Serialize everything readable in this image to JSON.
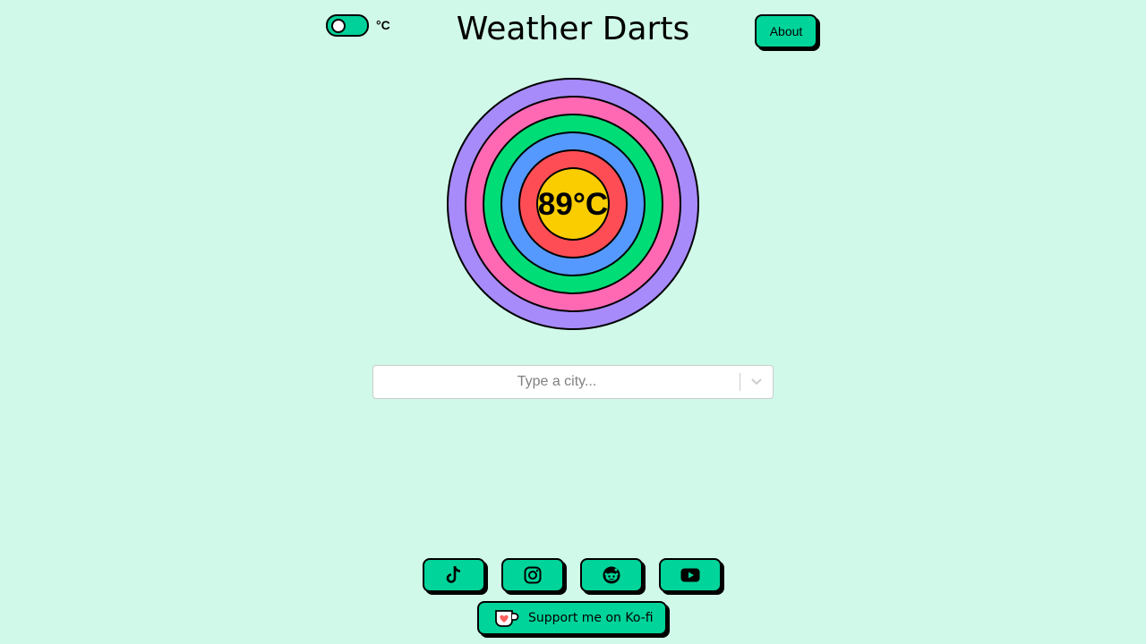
{
  "header": {
    "unit_toggle_label": "°C",
    "title": "Weather Darts",
    "about_label": "About"
  },
  "target": {
    "temperature": "89°C",
    "ring_colors": [
      "#a78bfa",
      "#ff69b4",
      "#00dd77",
      "#5599ff",
      "#ff4d55",
      "#f9cd00"
    ],
    "stroke_color": "#000000"
  },
  "search": {
    "placeholder": "Type a city..."
  },
  "footer": {
    "social_links": [
      {
        "name": "tiktok-icon"
      },
      {
        "name": "instagram-icon"
      },
      {
        "name": "reddit-icon"
      },
      {
        "name": "youtube-icon"
      }
    ],
    "kofi_label": "Support me on Ko-fi"
  },
  "colors": {
    "background": "#d0f9e9",
    "button": "#00d49a"
  }
}
